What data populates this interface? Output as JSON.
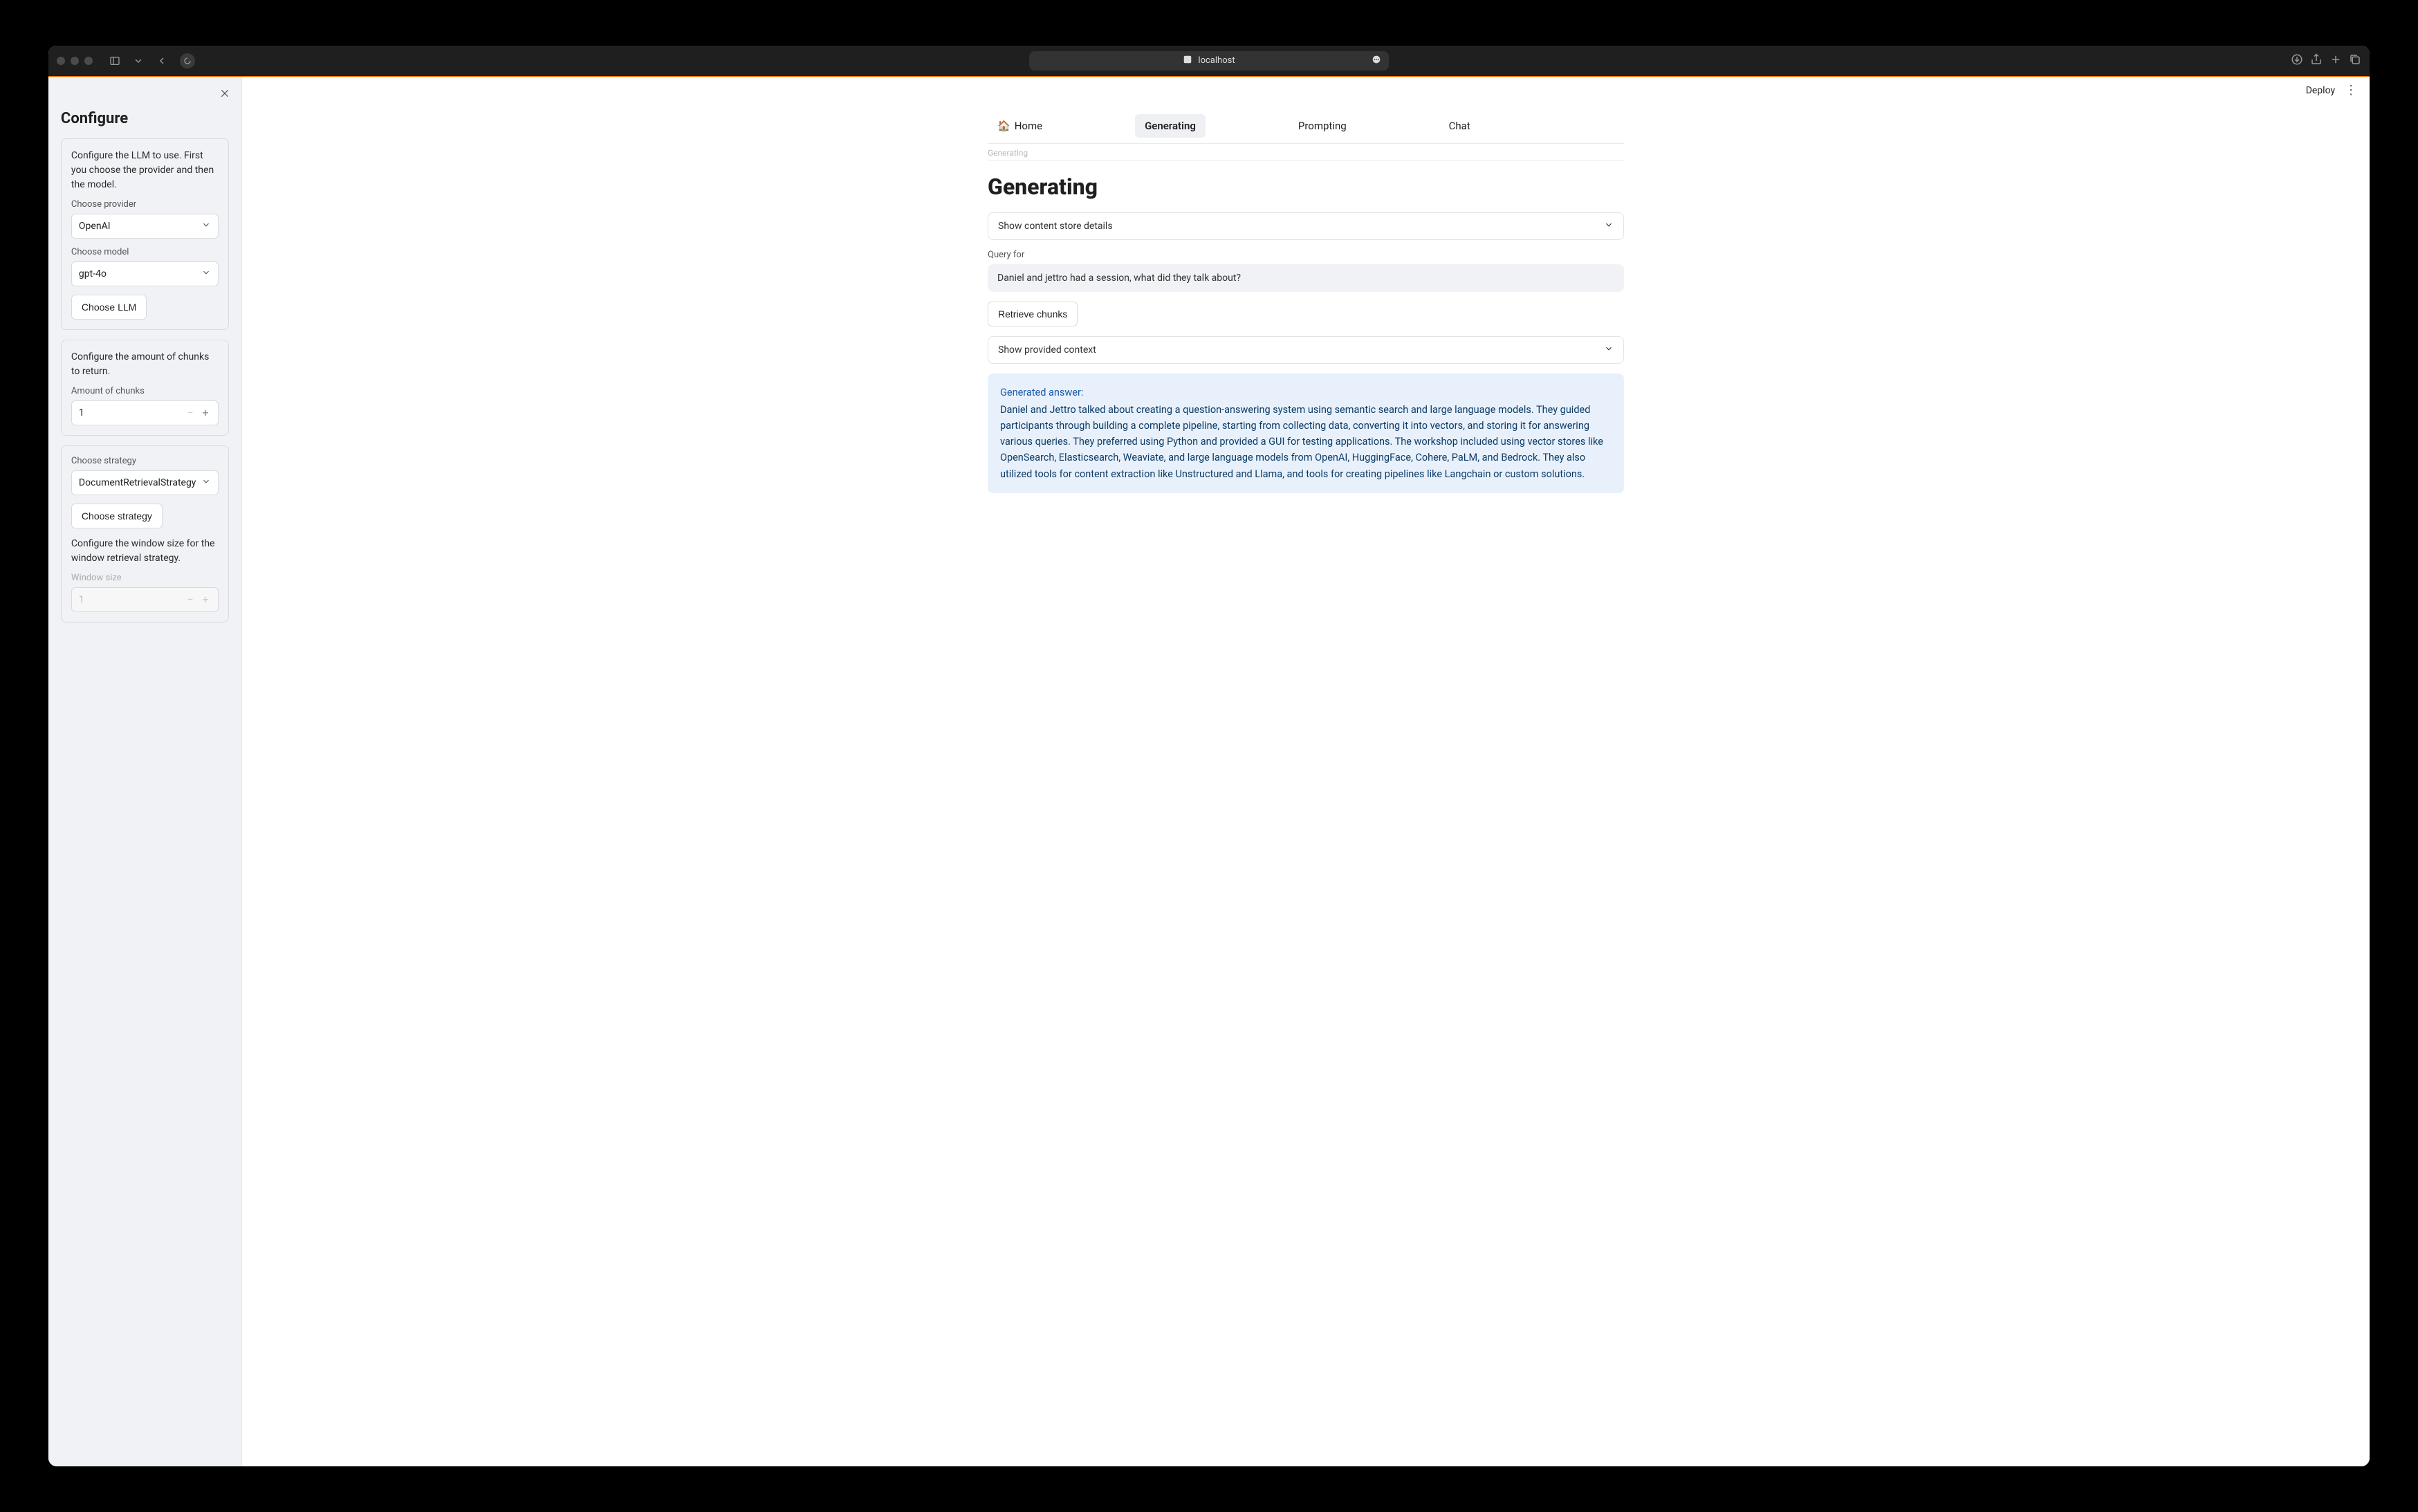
{
  "chrome": {
    "url": "localhost"
  },
  "topbar": {
    "deploy": "Deploy"
  },
  "tabs": {
    "home": "Home",
    "generating": "Generating",
    "prompting": "Prompting",
    "chat": "Chat",
    "sub": "Generating"
  },
  "sidebar": {
    "title": "Configure",
    "llm_card": {
      "desc": "Configure the LLM to use. First you choose the provider and then the model.",
      "provider_label": "Choose provider",
      "provider_value": "OpenAI",
      "model_label": "Choose model",
      "model_value": "gpt-4o",
      "choose_btn": "Choose LLM"
    },
    "chunks_card": {
      "desc": "Configure the amount of chunks to return.",
      "amount_label": "Amount of chunks",
      "amount_value": "1"
    },
    "strategy_card": {
      "strategy_label": "Choose strategy",
      "strategy_value": "DocumentRetrievalStrategy",
      "choose_btn": "Choose strategy",
      "window_desc": "Configure the window size for the window retrieval strategy.",
      "window_label": "Window size",
      "window_value": "1"
    }
  },
  "main": {
    "title": "Generating",
    "expander_store": "Show content store details",
    "query_label": "Query for",
    "query_value": "Daniel and jettro had a session, what did they talk about?",
    "retrieve_btn": "Retrieve chunks",
    "expander_context": "Show provided context",
    "answer_header": "Generated answer:",
    "answer_body": "Daniel and Jettro talked about creating a question-answering system using semantic search and large language models. They guided participants through building a complete pipeline, starting from collecting data, converting it into vectors, and storing it for answering various queries. They preferred using Python and provided a GUI for testing applications. The workshop included using vector stores like OpenSearch, Elasticsearch, Weaviate, and large language models from OpenAI, HuggingFace, Cohere, PaLM, and Bedrock. They also utilized tools for content extraction like Unstructured and Llama, and tools for creating pipelines like Langchain or custom solutions."
  }
}
